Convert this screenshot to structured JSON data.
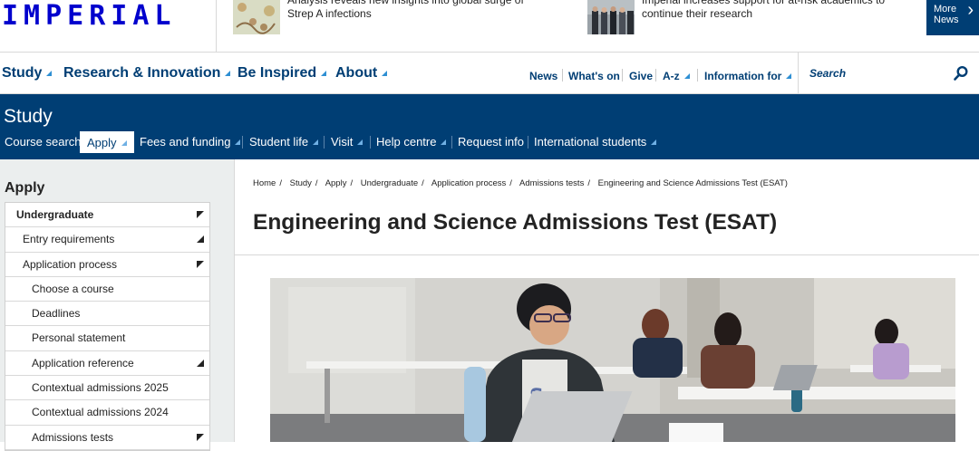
{
  "brand": {
    "logo_text": "IMPERIAL",
    "accent": "#003e74",
    "logo_color": "#0000cd",
    "link_triangle": "#2e8fd3"
  },
  "news": {
    "items": [
      {
        "text": "Analysis reveals new insights into global surge of Strep A infections",
        "thumb_icon": "bacteria-illustration"
      },
      {
        "text": "Imperial increases support for at-risk academics to continue their research",
        "thumb_icon": "group-photo"
      }
    ],
    "more_label_line1": "More",
    "more_label_line2": "News"
  },
  "mainnav": {
    "items": [
      {
        "label": "Study"
      },
      {
        "label": "Research & Innovation"
      },
      {
        "label": "Be Inspired"
      },
      {
        "label": "About"
      }
    ],
    "utility": [
      {
        "label": "News"
      },
      {
        "label": "What's on"
      },
      {
        "label": "Give"
      },
      {
        "label": "A-z"
      },
      {
        "label": "Information for"
      }
    ],
    "search_placeholder": "Search"
  },
  "section": {
    "title": "Study",
    "nav": [
      {
        "label": "Course search"
      },
      {
        "label": "Apply",
        "active": true
      },
      {
        "label": "Fees and funding"
      },
      {
        "label": "Student life"
      },
      {
        "label": "Visit"
      },
      {
        "label": "Help centre"
      },
      {
        "label": "Request info"
      },
      {
        "label": "International students"
      }
    ]
  },
  "sidebar": {
    "heading": "Apply",
    "items": [
      {
        "label": "Undergraduate"
      },
      {
        "label": "Entry requirements"
      },
      {
        "label": "Application process"
      },
      {
        "label": "Choose a course"
      },
      {
        "label": "Deadlines"
      },
      {
        "label": "Personal statement"
      },
      {
        "label": "Application reference"
      },
      {
        "label": "Contextual admissions 2025"
      },
      {
        "label": "Contextual admissions 2024"
      },
      {
        "label": "Admissions tests"
      }
    ]
  },
  "breadcrumb": [
    "Home",
    "Study",
    "Apply",
    "Undergraduate",
    "Application process",
    "Admissions tests",
    "Engineering and Science Admissions Test (ESAT)"
  ],
  "page": {
    "title": "Engineering and Science Admissions Test (ESAT)",
    "hero_icon": "students-studying-photo"
  }
}
